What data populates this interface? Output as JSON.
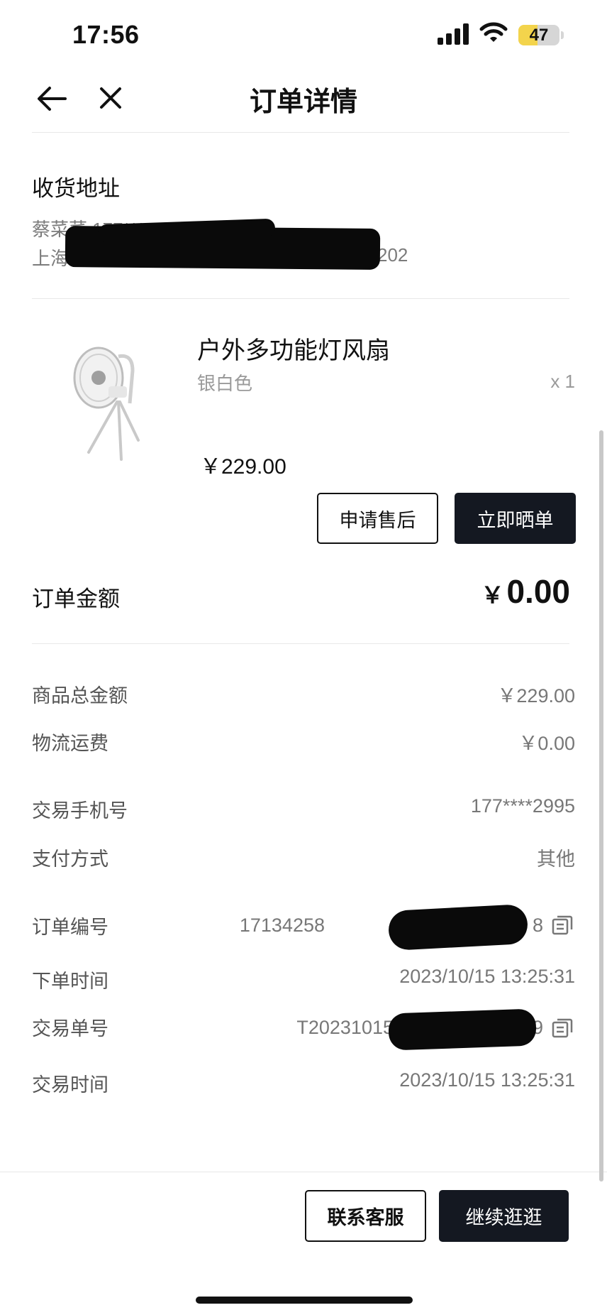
{
  "status_bar": {
    "time": "17:56",
    "battery_level": "47",
    "battery_fraction": 0.47,
    "icons": [
      "signal-icon",
      "wifi-icon",
      "battery-icon"
    ]
  },
  "nav": {
    "title": "订单详情",
    "back_icon": "arrow-left-icon",
    "close_icon": "close-icon"
  },
  "address": {
    "title": "收货地址",
    "name_phone_visible": "蔡菜菜  177****2995",
    "address_visible_start": "上海",
    "address_visible_end": "202"
  },
  "product": {
    "name": "户外多功能灯风扇",
    "variant": "银白色",
    "quantity": "x 1",
    "price": "￥229.00",
    "image_icon": "fan-product-image",
    "after_sale_label": "申请售后",
    "share_label": "立即晒单"
  },
  "order_amount": {
    "label": "订单金额",
    "currency": "￥",
    "value": "0.00"
  },
  "details": {
    "goods_total_label": "商品总金额",
    "goods_total_value": "￥229.00",
    "shipping_label": "物流运费",
    "shipping_value": "￥0.00",
    "phone_label": "交易手机号",
    "phone_value": "177****2995",
    "payment_label": "支付方式",
    "payment_value": "其他",
    "order_no_label": "订单编号",
    "order_no_visible_start": "17134258",
    "order_no_visible_end": "8",
    "order_time_label": "下单时间",
    "order_time_value": "2023/10/15 13:25:31",
    "trade_no_label": "交易单号",
    "trade_no_visible_start": "T20231015",
    "trade_no_visible_end": "9",
    "trade_time_label": "交易时间",
    "trade_time_value": "2023/10/15 13:25:31"
  },
  "footer": {
    "contact_label": "联系客服",
    "continue_label": "继续逛逛"
  },
  "colors": {
    "dark_button": "#141821",
    "battery_fill": "#f3d44c",
    "muted_text": "#777777"
  }
}
